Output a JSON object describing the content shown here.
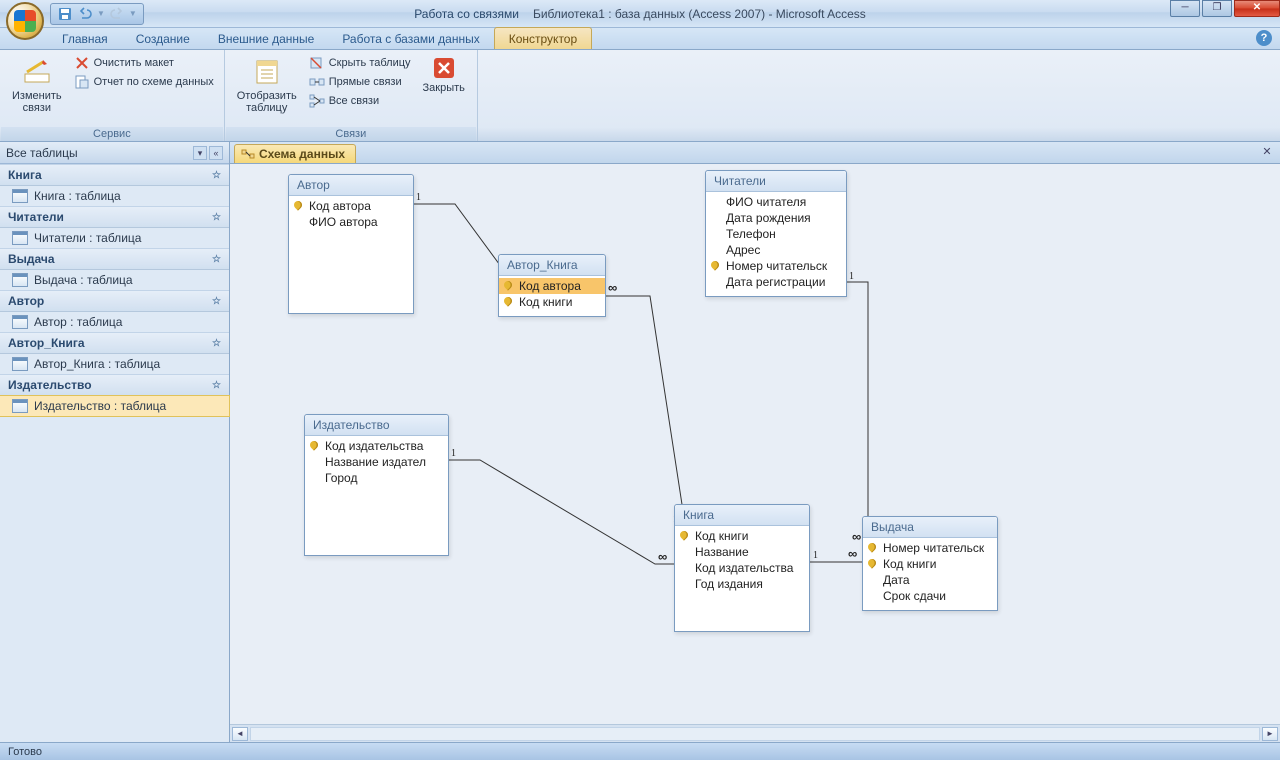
{
  "window": {
    "context_title": "Работа со связями",
    "doc_title": "Библиотека1 : база данных (Access 2007) - Microsoft Access"
  },
  "ribbon_tabs": {
    "t0": "Главная",
    "t1": "Создание",
    "t2": "Внешние данные",
    "t3": "Работа с базами данных",
    "t4": "Конструктор"
  },
  "ribbon": {
    "g1_label": "Сервис",
    "g2_label": "Связи",
    "edit_rel": "Изменить\nсвязи",
    "clear_layout": "Очистить макет",
    "rel_report": "Отчет по схеме данных",
    "show_table": "Отобразить\nтаблицу",
    "hide_table": "Скрыть таблицу",
    "direct_rel": "Прямые связи",
    "all_rel": "Все связи",
    "close": "Закрыть"
  },
  "nav": {
    "header": "Все таблицы",
    "groups": [
      {
        "name": "Книга",
        "items": [
          "Книга : таблица"
        ]
      },
      {
        "name": "Читатели",
        "items": [
          "Читатели : таблица"
        ]
      },
      {
        "name": "Выдача",
        "items": [
          "Выдача : таблица"
        ]
      },
      {
        "name": "Автор",
        "items": [
          "Автор : таблица"
        ]
      },
      {
        "name": "Автор_Книга",
        "items": [
          "Автор_Книга : таблица"
        ]
      },
      {
        "name": "Издательство",
        "items": [
          "Издательство : таблица"
        ]
      }
    ]
  },
  "doc_tab": "Схема данных",
  "tables": {
    "avtor": {
      "title": "Автор",
      "fields": [
        {
          "n": "Код автора",
          "pk": true
        },
        {
          "n": "ФИО автора"
        }
      ]
    },
    "avtor_kniga": {
      "title": "Автор_Книга",
      "fields": [
        {
          "n": "Код автора",
          "pk": true,
          "sel": true
        },
        {
          "n": "Код книги",
          "pk": true
        }
      ]
    },
    "chitateli": {
      "title": "Читатели",
      "fields": [
        {
          "n": "ФИО читателя"
        },
        {
          "n": "Дата рождения"
        },
        {
          "n": "Телефон"
        },
        {
          "n": "Адрес"
        },
        {
          "n": "Номер  читательск",
          "pk": true
        },
        {
          "n": "Дата регистрации"
        }
      ]
    },
    "izdat": {
      "title": "Издательство",
      "fields": [
        {
          "n": "Код издательства",
          "pk": true
        },
        {
          "n": "Название издател"
        },
        {
          "n": "Город"
        }
      ]
    },
    "kniga": {
      "title": "Книга",
      "fields": [
        {
          "n": "Код книги",
          "pk": true
        },
        {
          "n": "Название"
        },
        {
          "n": "Код издательства"
        },
        {
          "n": "Год издания"
        }
      ]
    },
    "vydacha": {
      "title": "Выдача",
      "fields": [
        {
          "n": "Номер читательск",
          "pk": true
        },
        {
          "n": "Код книги",
          "pk": true
        },
        {
          "n": "Дата"
        },
        {
          "n": "Срок сдачи"
        }
      ]
    }
  },
  "status": "Готово"
}
